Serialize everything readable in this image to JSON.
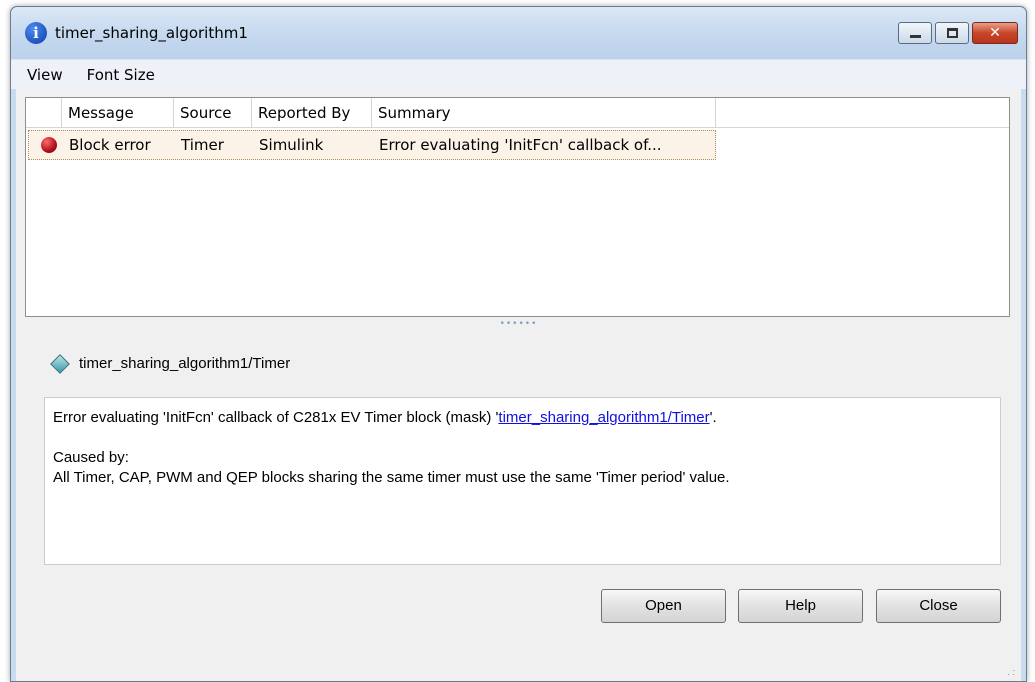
{
  "window": {
    "title": "timer_sharing_algorithm1",
    "icon": "info-icon",
    "controls": [
      "minimize",
      "maximize",
      "close"
    ]
  },
  "menu": {
    "view": "View",
    "font_size": "Font Size"
  },
  "table": {
    "columns": [
      "Message",
      "Source",
      "Reported By",
      "Summary"
    ],
    "rows": [
      {
        "status_icon": "error-icon",
        "message": "Block error",
        "source": "Timer",
        "reported_by": "Simulink",
        "summary": "Error evaluating 'InitFcn' callback of..."
      }
    ]
  },
  "detail": {
    "block_path": "timer_sharing_algorithm1/Timer",
    "block_icon": "block-icon",
    "line1_prefix": "Error evaluating 'InitFcn' callback of C281x EV Timer block (mask) '",
    "line1_link": "timer_sharing_algorithm1/Timer",
    "line1_suffix": "'.",
    "caused_by": "Caused by:",
    "cause": "All Timer, CAP, PWM and QEP blocks sharing the same timer must use the same 'Timer period' value."
  },
  "buttons": {
    "open": "Open",
    "help": "Help",
    "close": "Close"
  },
  "colors": {
    "error": "#c0101a",
    "link": "#1010e0",
    "titlebar": "#c3d7ee"
  }
}
